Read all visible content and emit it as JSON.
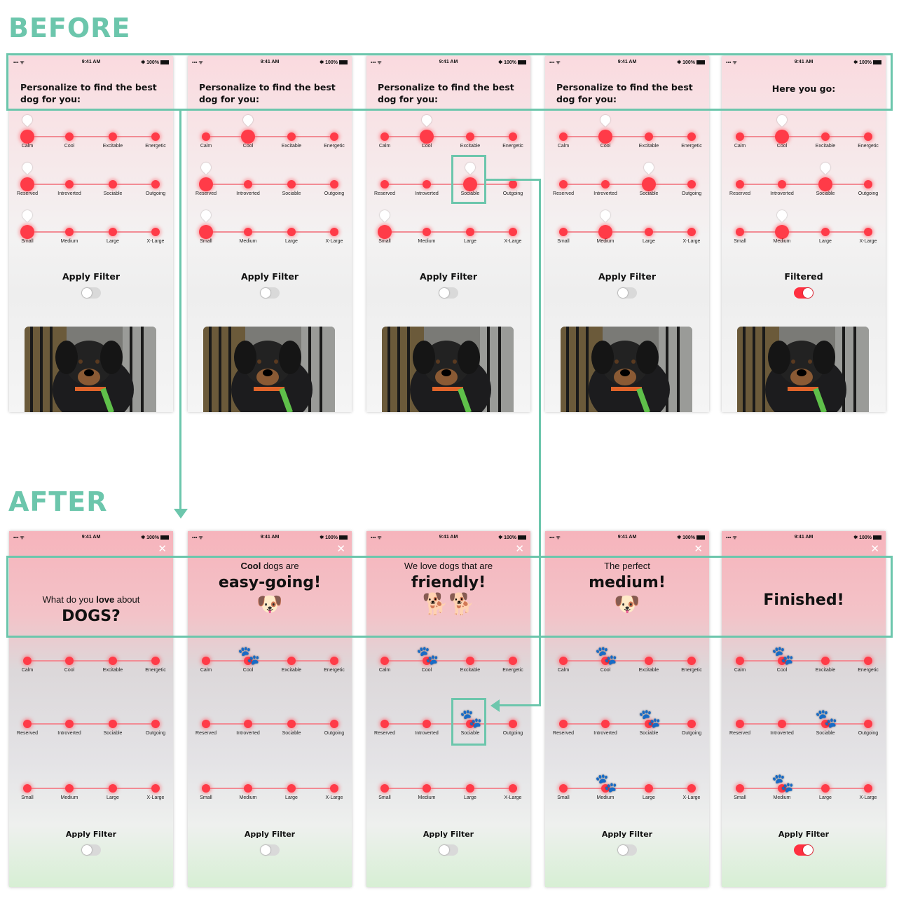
{
  "sections": {
    "before": "BEFORE",
    "after": "AFTER"
  },
  "status_bar": {
    "time": "9:41 AM",
    "battery": "100%",
    "signal": "▪▪▪ ᯤ",
    "bluetooth": "✱"
  },
  "slider_groups": [
    [
      "Calm",
      "Cool",
      "Excitable",
      "Energetic"
    ],
    [
      "Reserved",
      "Introverted",
      "Sociable",
      "Outgoing"
    ],
    [
      "Small",
      "Medium",
      "Large",
      "X-Large"
    ]
  ],
  "before": {
    "screens": [
      {
        "header": "Personalize to find the best dog for you:",
        "apply": "Apply Filter",
        "toggle_on": false,
        "selected": [
          0,
          0,
          0
        ]
      },
      {
        "header": "Personalize to find the best dog for you:",
        "apply": "Apply Filter",
        "toggle_on": false,
        "selected": [
          1,
          0,
          0
        ]
      },
      {
        "header": "Personalize to find the best dog for you:",
        "apply": "Apply Filter",
        "toggle_on": false,
        "selected": [
          1,
          2,
          0
        ]
      },
      {
        "header": "Personalize to find the best dog for you:",
        "apply": "Apply Filter",
        "toggle_on": false,
        "selected": [
          1,
          2,
          1
        ]
      },
      {
        "header": "Here you go:",
        "apply": "Filtered",
        "toggle_on": true,
        "selected": [
          1,
          2,
          1
        ]
      }
    ]
  },
  "after": {
    "close_icon": "✕",
    "screens": [
      {
        "small": "What do you love about",
        "small_bold": "love",
        "big": "DOGS?",
        "icon": "",
        "apply": "Apply Filter",
        "toggle_on": false,
        "selected": [
          null,
          null,
          null
        ]
      },
      {
        "small": "Cool dogs are",
        "small_bold": "Cool",
        "big": "easy-going!",
        "icon": "cool-dog-icon",
        "apply": "Apply Filter",
        "toggle_on": false,
        "selected": [
          1,
          null,
          null
        ]
      },
      {
        "small": "We love dogs that are",
        "small_bold": "",
        "big": "friendly!",
        "icon": "playing-dogs-icon",
        "apply": "Apply Filter",
        "toggle_on": false,
        "selected": [
          1,
          2,
          null
        ]
      },
      {
        "small": "The perfect",
        "small_bold": "",
        "big": "medium!",
        "icon": "dog-face-icon",
        "apply": "Apply Filter",
        "toggle_on": false,
        "selected": [
          1,
          2,
          1
        ]
      },
      {
        "small": "",
        "small_bold": "",
        "big": "Finished!",
        "icon": "",
        "apply": "Apply Filter",
        "toggle_on": true,
        "selected": [
          1,
          2,
          1
        ]
      }
    ]
  },
  "colors": {
    "accent": "#6cc6ac",
    "slider": "#ff3b48",
    "toggle_on": "#ff3040"
  }
}
